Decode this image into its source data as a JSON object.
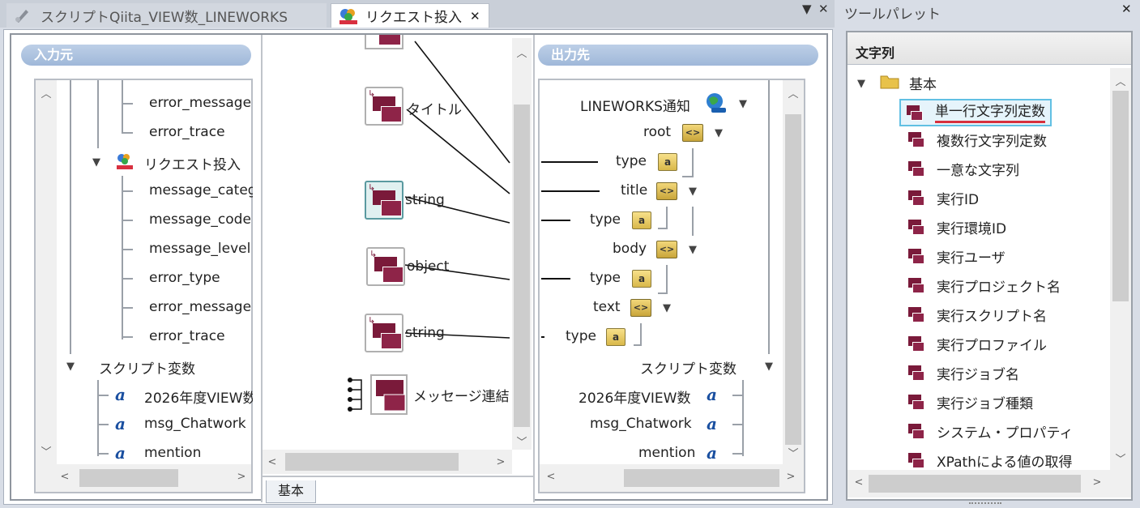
{
  "tabs": [
    {
      "label": "スクリプトQiita_VIEW数_LINEWORKS",
      "active": false
    },
    {
      "label": "リクエスト投入",
      "active": true,
      "close": "✕"
    }
  ],
  "window_controls": {
    "menu": "▼",
    "close": "✕"
  },
  "source_panel": {
    "header": "入力元",
    "items": [
      {
        "label": "error_message",
        "icon": "none"
      },
      {
        "label": "error_trace",
        "icon": "none"
      },
      {
        "label": "リクエスト投入",
        "icon": "request-icon",
        "expanded": true
      },
      {
        "label": "message_categ",
        "icon": "none"
      },
      {
        "label": "message_code",
        "icon": "none"
      },
      {
        "label": "message_level",
        "icon": "none"
      },
      {
        "label": "error_type",
        "icon": "none"
      },
      {
        "label": "error_message",
        "icon": "none"
      },
      {
        "label": "error_trace",
        "icon": "none"
      },
      {
        "label": "スクリプト変数",
        "icon": "none",
        "expanded": true
      },
      {
        "label": "2026年度VIEW数",
        "icon": "variable-icon"
      },
      {
        "label": "msg_Chatwork",
        "icon": "variable-icon"
      },
      {
        "label": "mention",
        "icon": "variable-star-icon"
      }
    ]
  },
  "canvas": {
    "nodes": [
      {
        "label": "タイトル",
        "icon": "string-constant-icon"
      },
      {
        "label": "string",
        "icon": "string-constant-icon",
        "selected": true
      },
      {
        "label": "object",
        "icon": "string-constant-icon"
      },
      {
        "label": "string",
        "icon": "string-constant-icon"
      },
      {
        "label": "メッセージ連結",
        "icon": "message-concat-icon"
      }
    ],
    "bottom_tab": "基本"
  },
  "target_panel": {
    "header": "出力先",
    "items": [
      {
        "label": "LINEWORKS通知",
        "icon": "rest-globe-icon",
        "expanded": true
      },
      {
        "label": "root",
        "icon": "object-icon",
        "expanded": true
      },
      {
        "label": "type",
        "icon": "text-type-icon"
      },
      {
        "label": "title",
        "icon": "object-icon",
        "expanded": true
      },
      {
        "label": "type",
        "icon": "text-type-icon"
      },
      {
        "label": "body",
        "icon": "object-icon",
        "expanded": true
      },
      {
        "label": "type",
        "icon": "text-type-icon"
      },
      {
        "label": "text",
        "icon": "object-icon",
        "expanded": true
      },
      {
        "label": "type",
        "icon": "text-type-icon"
      },
      {
        "label": "スクリプト変数",
        "icon": "none",
        "expanded": true
      },
      {
        "label": "2026年度VIEW数",
        "icon": "variable-icon"
      },
      {
        "label": "msg_Chatwork",
        "icon": "variable-icon"
      },
      {
        "label": "mention",
        "icon": "variable-star-icon"
      }
    ]
  },
  "palette": {
    "title": "ツールパレット",
    "close": "✕",
    "category": "文字列",
    "folder": "基本",
    "items": [
      {
        "label": "単一行文字列定数",
        "selected": true
      },
      {
        "label": "複数行文字列定数"
      },
      {
        "label": "一意な文字列"
      },
      {
        "label": "実行ID"
      },
      {
        "label": "実行環境ID"
      },
      {
        "label": "実行ユーザ"
      },
      {
        "label": "実行プロジェクト名"
      },
      {
        "label": "実行スクリプト名"
      },
      {
        "label": "実行プロファイル"
      },
      {
        "label": "実行ジョブ名"
      },
      {
        "label": "実行ジョブ種類"
      },
      {
        "label": "システム・プロパティ"
      },
      {
        "label": "XPathによる値の取得"
      }
    ]
  },
  "glyphs": {
    "up": "︿",
    "down": "﹀",
    "left": "<",
    "right": ">",
    "expand": "▼",
    "text_type": "a",
    "object": "<>",
    "var": "a"
  }
}
